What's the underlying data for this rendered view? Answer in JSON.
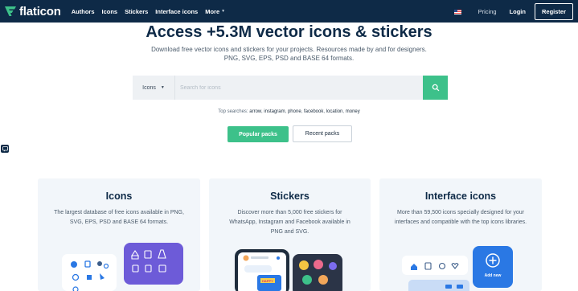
{
  "header": {
    "logo_text": "flaticon",
    "nav": [
      "Authors",
      "Icons",
      "Stickers",
      "Interface icons"
    ],
    "more_label": "More",
    "pricing_label": "Pricing",
    "login_label": "Login",
    "register_label": "Register"
  },
  "hero": {
    "title": "Access +5.3M vector icons & stickers",
    "subtitle_line1": "Download free vector icons and stickers for your projects. Resources made by and for designers.",
    "subtitle_line2": "PNG, SVG, EPS, PSD and BASE 64 formats."
  },
  "search": {
    "type_value": "Icons",
    "placeholder": "Search for icons"
  },
  "top_searches": {
    "label": "Top searches:",
    "terms": [
      "arrow",
      "instagram",
      "phone",
      "facebook",
      "location",
      "money"
    ]
  },
  "buttons": {
    "popular": "Popular packs",
    "recent": "Recent packs"
  },
  "cards": [
    {
      "title": "Icons",
      "desc": "The largest database of free icons available in PNG, SVG, EPS, PSD and BASE 64 formats."
    },
    {
      "title": "Stickers",
      "desc": "Discover more than 5,000 free stickers for WhatsApp, Instagram and Facebook available in PNG and SVG."
    },
    {
      "title": "Interface icons",
      "desc": "More than 59,500 icons specially designed for your interfaces and compatible with the top icons libraries."
    }
  ],
  "illustrations": {
    "add_new_label": "Add new",
    "happy_label": "HAPPY"
  },
  "colors": {
    "navy": "#0e2a47",
    "green": "#3dc18a",
    "blue": "#2a78e4",
    "purple": "#6d5bd8"
  }
}
